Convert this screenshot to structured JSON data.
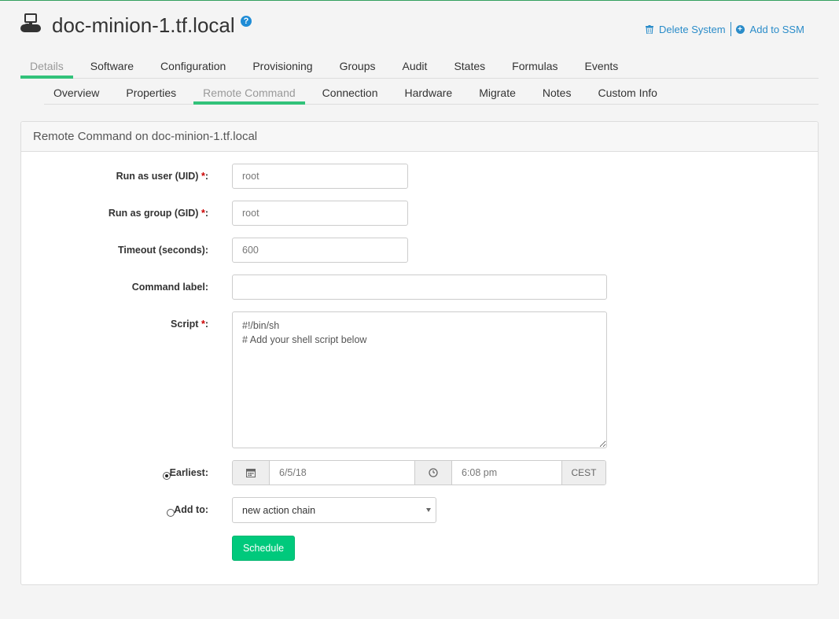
{
  "header": {
    "title": "doc-minion-1.tf.local",
    "help_icon_label": "?",
    "actions": [
      {
        "label": "Delete System",
        "icon": "trash-icon"
      },
      {
        "label": "Add to SSM",
        "icon": "plus-circle-icon"
      }
    ]
  },
  "tabs_primary": [
    {
      "label": "Details",
      "active": true
    },
    {
      "label": "Software"
    },
    {
      "label": "Configuration"
    },
    {
      "label": "Provisioning"
    },
    {
      "label": "Groups"
    },
    {
      "label": "Audit"
    },
    {
      "label": "States"
    },
    {
      "label": "Formulas"
    },
    {
      "label": "Events"
    }
  ],
  "tabs_secondary": [
    {
      "label": "Overview"
    },
    {
      "label": "Properties"
    },
    {
      "label": "Remote Command",
      "active": true
    },
    {
      "label": "Connection"
    },
    {
      "label": "Hardware"
    },
    {
      "label": "Migrate"
    },
    {
      "label": "Notes"
    },
    {
      "label": "Custom Info"
    }
  ],
  "panel": {
    "title": "Remote Command on doc-minion-1.tf.local"
  },
  "form": {
    "run_as_user": {
      "label": "Run as user (UID)",
      "required_mark": "*",
      "colon": ":",
      "value": "root"
    },
    "run_as_group": {
      "label": "Run as group (GID)",
      "required_mark": "*",
      "colon": ":",
      "value": "root"
    },
    "timeout": {
      "label": "Timeout (seconds):",
      "value": "600"
    },
    "command_label": {
      "label": "Command label:",
      "value": ""
    },
    "script": {
      "label": "Script",
      "required_mark": "*",
      "colon": ":",
      "value": "#!/bin/sh\n# Add your shell script below"
    },
    "earliest": {
      "label": "Earliest:",
      "date": "6/5/18",
      "time": "6:08 pm",
      "timezone": "CEST",
      "selected": true
    },
    "add_to": {
      "label": "Add to:",
      "value": "new action chain",
      "selected": false
    },
    "schedule_button": "Schedule"
  },
  "colors": {
    "accent_green": "#32c27a",
    "button_green": "#00c97c",
    "link_blue": "#2a8cc9",
    "required_red": "#cc0000"
  }
}
